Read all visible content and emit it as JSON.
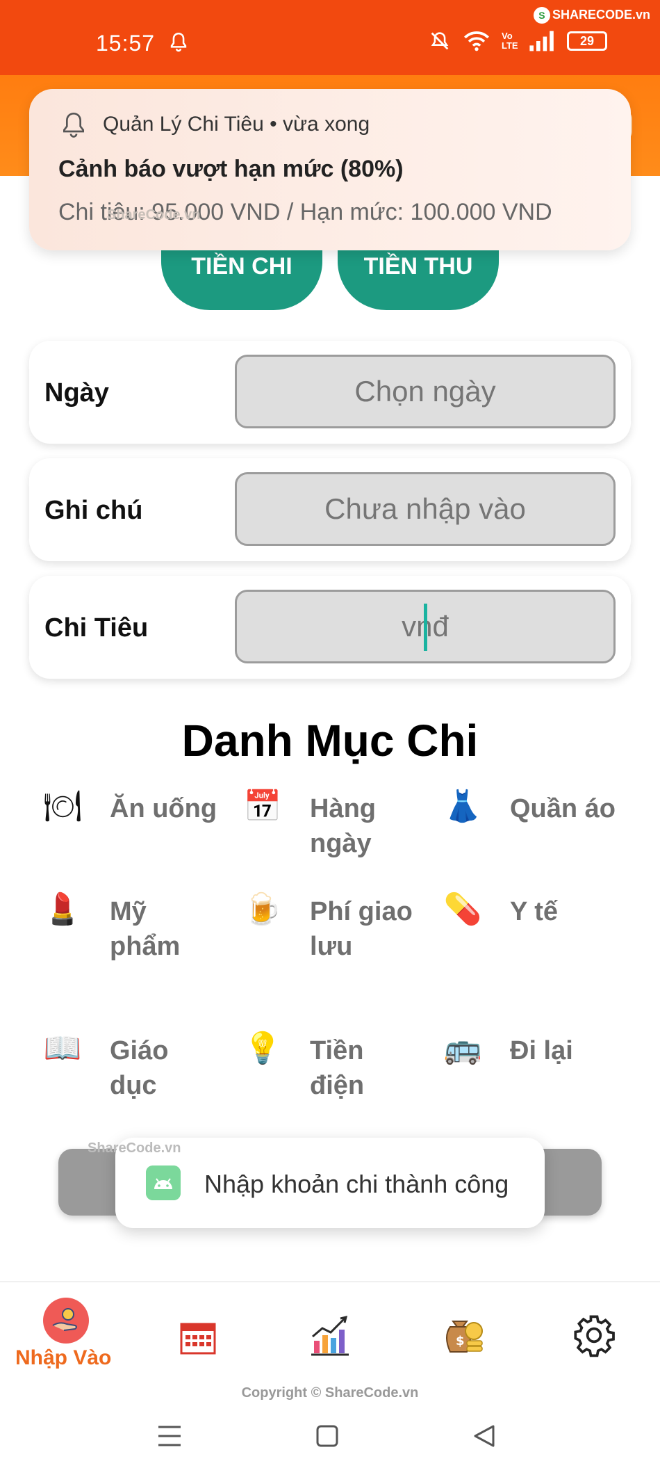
{
  "status_bar": {
    "time": "15:57",
    "battery": "29",
    "network_label": "Vo LTE",
    "watermark": "SHARECODE.vn"
  },
  "notification": {
    "app_line": "Quản Lý Chi Tiêu • vừa xong",
    "title": "Cảnh báo vượt hạn mức (80%)",
    "body": "Chi tiêu: 95.000 VND / Hạn mức: 100.000 VND",
    "watermark": "ShareCode.vn"
  },
  "type_buttons": {
    "expense": "TIỀN CHI",
    "income": "TIỀN THU"
  },
  "form": {
    "date_label": "Ngày",
    "date_placeholder": "Chọn ngày",
    "note_label": "Ghi chú",
    "note_placeholder": "Chưa nhập vào",
    "amount_label": "Chi Tiêu",
    "amount_placeholder": "vnđ"
  },
  "category": {
    "title": "Danh Mục Chi",
    "items": [
      {
        "label": "Ăn uống",
        "icon": "🍽"
      },
      {
        "label": "Hàng ngày",
        "icon": "📅"
      },
      {
        "label": "Quần áo",
        "icon": "👗"
      },
      {
        "label": "Mỹ phẩm",
        "icon": "💄"
      },
      {
        "label": "Phí giao lưu",
        "icon": "🍺"
      },
      {
        "label": "Y tế",
        "icon": "💊"
      },
      {
        "label": "Giáo dục",
        "icon": "📖"
      },
      {
        "label": "Tiền điện",
        "icon": "💡"
      },
      {
        "label": "Đi lại",
        "icon": "🚌"
      }
    ]
  },
  "toast": {
    "message": "Nhập khoản chi thành công",
    "watermark": "ShareCode.vn"
  },
  "bottom_nav": {
    "active_label": "Nhập Vào",
    "items": [
      "input-icon",
      "calendar-icon",
      "chart-icon",
      "money-bag-icon",
      "settings-icon"
    ]
  },
  "copyright": "Copyright © ShareCode.vn",
  "colors": {
    "status_bar": "#f2490f",
    "header": "#ff7d10",
    "primary_button": "#1c9a80",
    "active_nav": "#ee6a1e"
  }
}
